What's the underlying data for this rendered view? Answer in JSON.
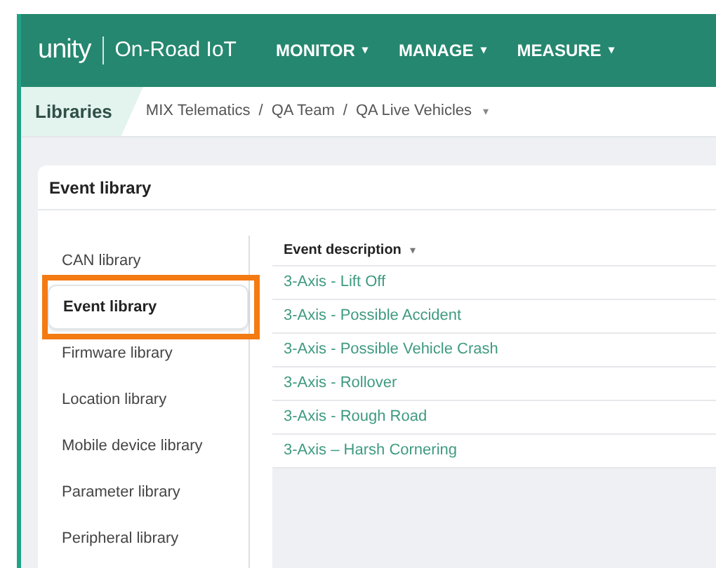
{
  "header": {
    "logo": "unity",
    "product": "On-Road IoT",
    "menus": [
      {
        "label": "MONITOR",
        "caret": "▾"
      },
      {
        "label": "MANAGE",
        "caret": "▾"
      },
      {
        "label": "MEASURE",
        "caret": "▾"
      }
    ]
  },
  "breadcrumb": {
    "section": "Libraries",
    "path": [
      {
        "label": "MIX Telematics"
      },
      {
        "label": "QA Team"
      },
      {
        "label": "QA Live Vehicles"
      }
    ],
    "separator": "/",
    "caret": "▾"
  },
  "card": {
    "title": "Event library"
  },
  "sidebar": {
    "items": [
      {
        "label": "CAN library",
        "selected": false,
        "highlighted": false
      },
      {
        "label": "Event library",
        "selected": true,
        "highlighted": true
      },
      {
        "label": "Firmware library",
        "selected": false,
        "highlighted": false
      },
      {
        "label": "Location library",
        "selected": false,
        "highlighted": false
      },
      {
        "label": "Mobile device library",
        "selected": false,
        "highlighted": false
      },
      {
        "label": "Parameter library",
        "selected": false,
        "highlighted": false
      },
      {
        "label": "Peripheral library",
        "selected": false,
        "highlighted": false
      }
    ]
  },
  "table": {
    "column": "Event description",
    "sort_caret": "▾",
    "rows": [
      {
        "description": "3-Axis - Lift Off"
      },
      {
        "description": "3-Axis - Possible Accident"
      },
      {
        "description": "3-Axis - Possible Vehicle Crash"
      },
      {
        "description": "3-Axis - Rollover"
      },
      {
        "description": "3-Axis - Rough Road"
      },
      {
        "description": "3-Axis – Harsh Cornering"
      }
    ]
  }
}
